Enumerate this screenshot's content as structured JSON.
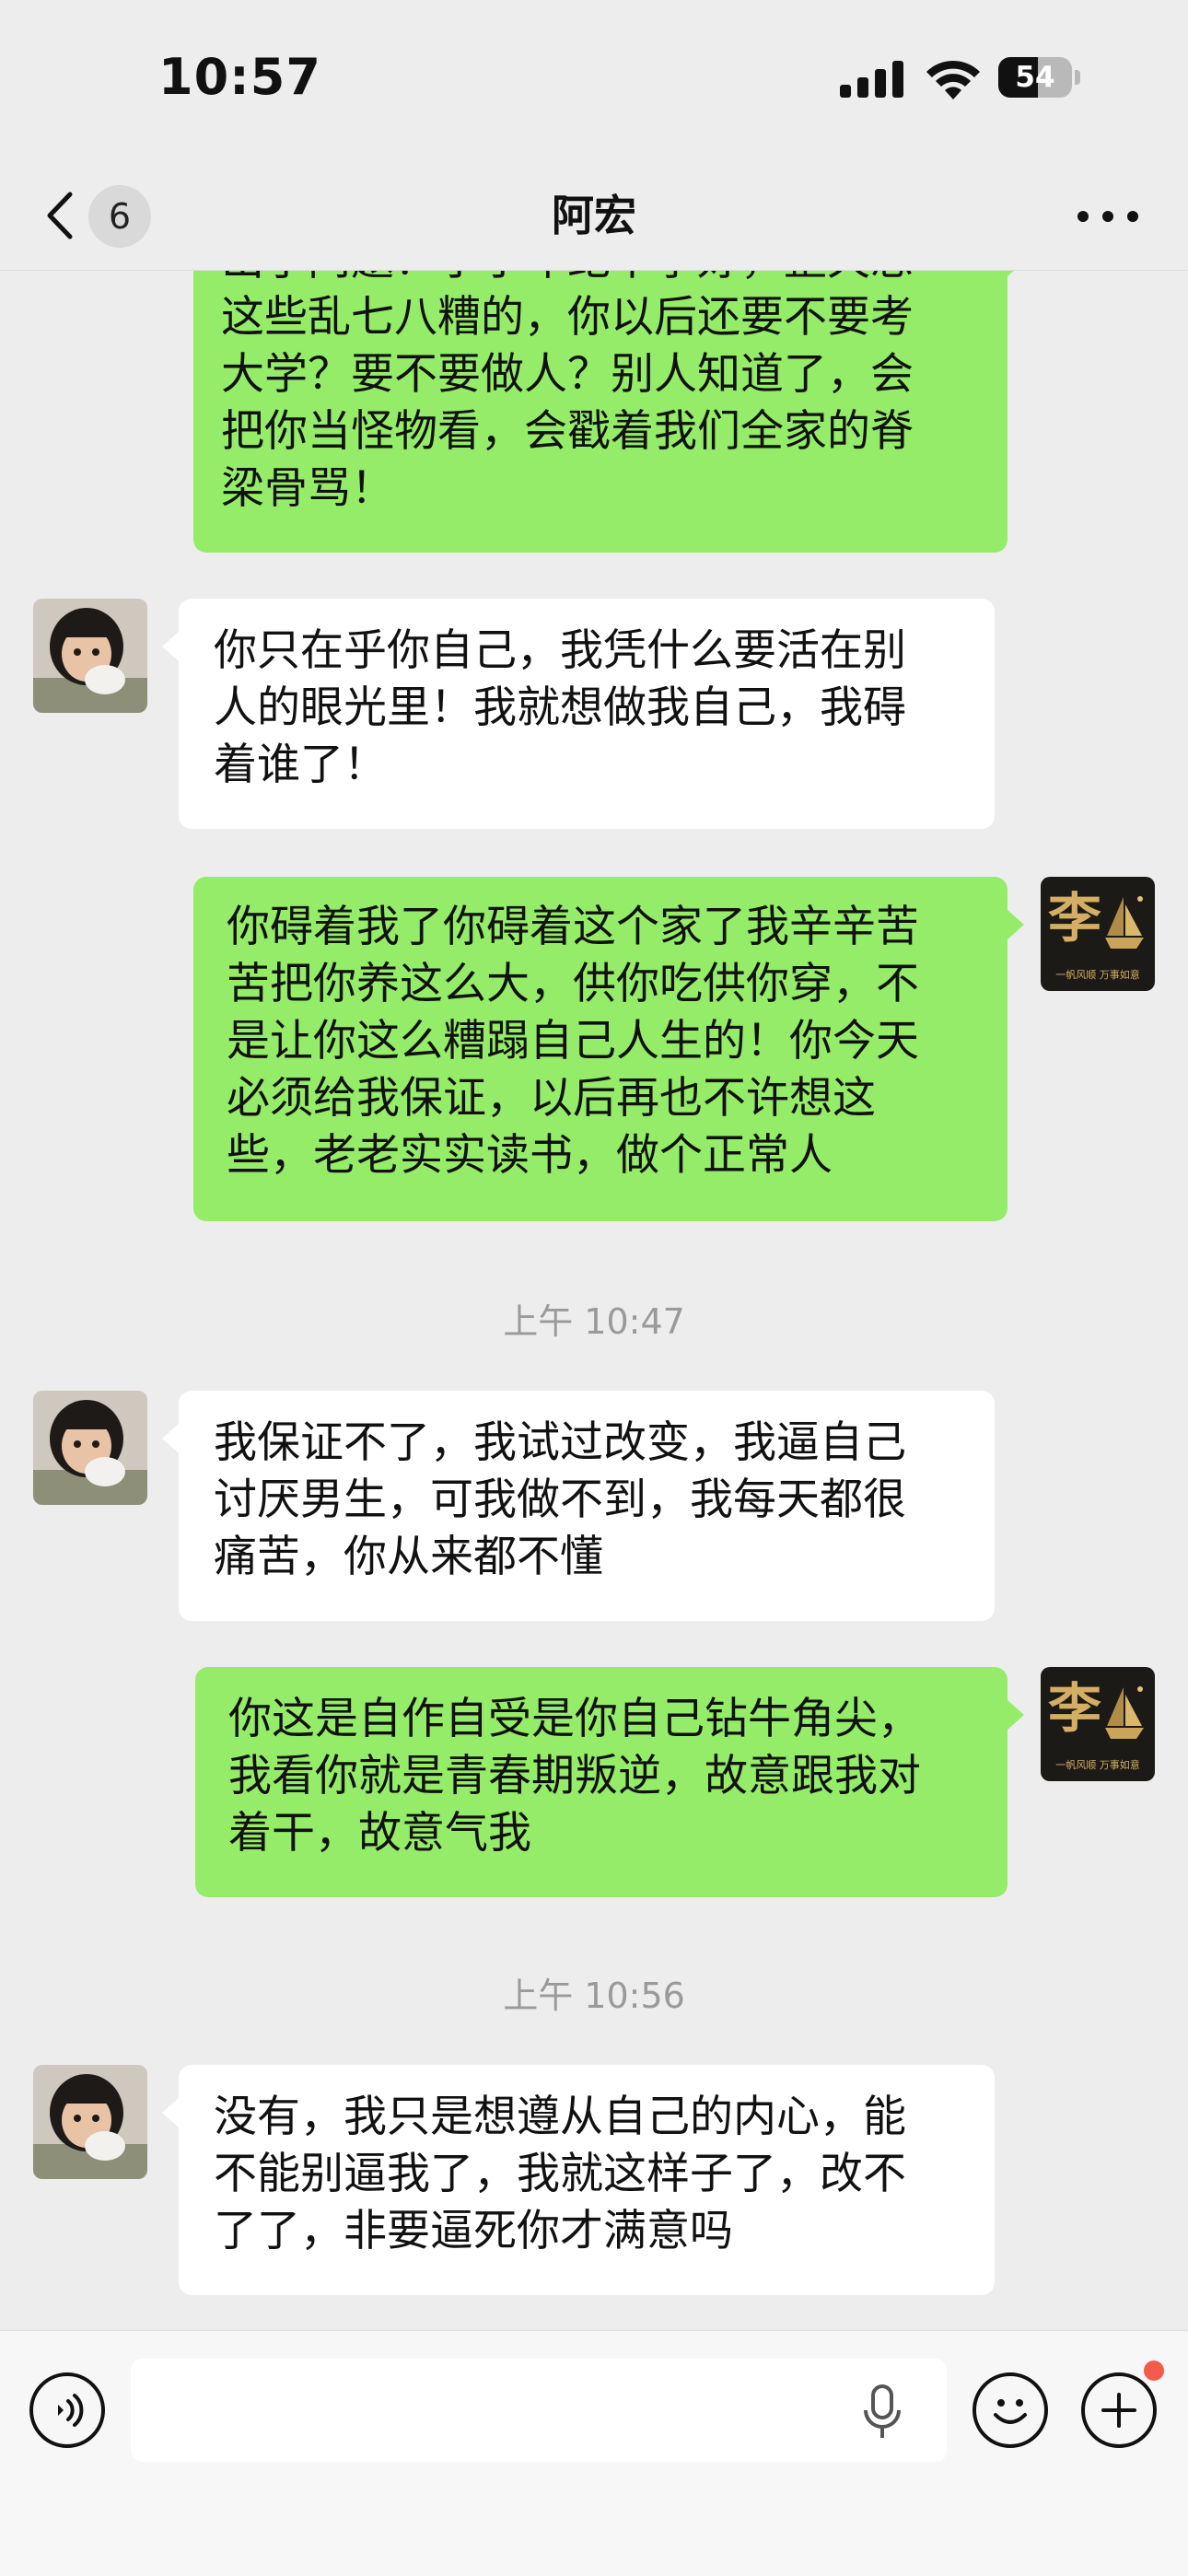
{
  "status_bar": {
    "time": "10:57",
    "battery_level": "54"
  },
  "nav": {
    "unread_count": "6",
    "title": "阿宏"
  },
  "messages": [
    {
      "side": "out",
      "lines": [
        "出了问题！小小年纪不学好，整天想",
        "这些乱七八糟的，你以后还要不要考",
        "大学？要不要做人？别人知道了，会",
        "把你当怪物看，会戳着我们全家的脊",
        "梁骨骂！"
      ]
    },
    {
      "side": "in",
      "lines": [
        "你只在乎你自己，我凭什么要活在别",
        "人的眼光里！我就想做我自己，我碍",
        "着谁了！"
      ]
    },
    {
      "side": "out",
      "lines": [
        "你碍着我了你碍着这个家了我辛辛苦",
        "苦把你养这么大，供你吃供你穿，不",
        "是让你这么糟蹋自己人生的！你今天",
        "必须给我保证，以后再也不许想这",
        "些，老老实实读书，做个正常人"
      ]
    },
    {
      "side": "time",
      "text": "上午 10:47"
    },
    {
      "side": "in",
      "lines": [
        "我保证不了，我试过改变，我逼自己",
        "讨厌男生，可我做不到，我每天都很",
        "痛苦，你从来都不懂"
      ]
    },
    {
      "side": "out",
      "lines": [
        "你这是自作自受是你自己钻牛角尖，",
        "我看你就是青春期叛逆，故意跟我对",
        "着干，故意气我"
      ]
    },
    {
      "side": "time",
      "text": "上午 10:56"
    },
    {
      "side": "in",
      "lines": [
        "没有，我只是想遵从自己的内心，能",
        "不能别逼我了，我就这样子了，改不",
        "了了，非要逼死你才满意吗"
      ]
    }
  ],
  "avatar_self": {
    "logo_char": "李",
    "tagline": "一帆风顺 万事如意"
  },
  "colors": {
    "background": "#ededed",
    "incoming_bubble": "#ffffff",
    "outgoing_bubble": "#95ec69",
    "badge_dot": "#f45b4b"
  },
  "input_bar": {
    "icons": [
      "voice-icon",
      "microphone-icon",
      "emoji-icon",
      "plus-icon"
    ]
  }
}
